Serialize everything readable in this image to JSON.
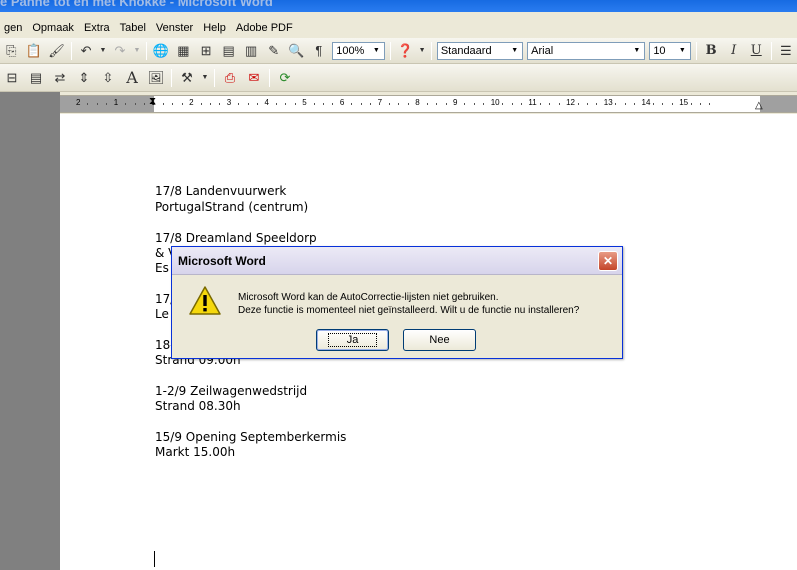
{
  "window": {
    "title": "e Panne tot en met Knokke - Microsoft Word"
  },
  "menu": [
    "gen",
    "Opmaak",
    "Extra",
    "Tabel",
    "Venster",
    "Help",
    "Adobe PDF"
  ],
  "toolbar": {
    "zoom": "100%",
    "style": "Standaard",
    "font": "Arial",
    "size": "10",
    "bold": "B",
    "italic": "I",
    "underline": "U",
    "pilcrow": "¶",
    "font_a": "A"
  },
  "ruler": {
    "numbers": [
      "2",
      "1",
      "1",
      "2",
      "3",
      "4",
      "5",
      "6",
      "7",
      "8",
      "9",
      "10",
      "11",
      "12",
      "13",
      "14",
      "15"
    ]
  },
  "document": {
    "lines": [
      "17/8 Landenvuurwerk",
      "PortugalStrand (centrum)",
      "17/8 Dreamland Speeldorp",
      "& V",
      "Es",
      "17/",
      "Le",
      "18-",
      "Strand 09.00h",
      "1-2/9 Zeilwagenwedstrijd",
      "Strand 08.30h",
      "15/9 Opening Septemberkermis",
      "Markt 15.00h"
    ]
  },
  "dialog": {
    "title": "Microsoft Word",
    "message_line1": "Microsoft Word kan de AutoCorrectie-lijsten niet gebruiken.",
    "message_line2": "Deze functie is momenteel niet geïnstalleerd. Wilt u de functie nu installeren?",
    "yes_label": "Ja",
    "no_label": "Nee"
  }
}
